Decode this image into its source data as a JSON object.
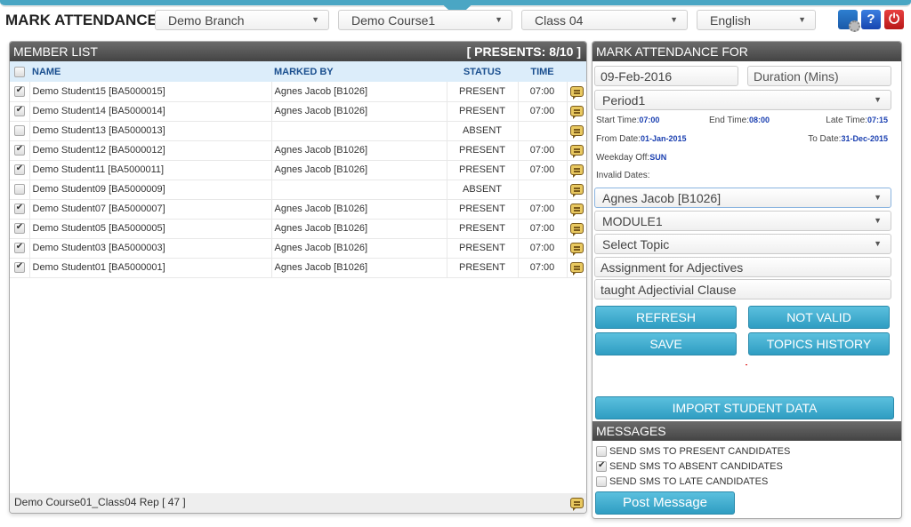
{
  "header": {
    "title": "MARK ATTENDANCE",
    "branch": "Demo Branch",
    "course": "Demo Course1",
    "class": "Class 04",
    "language": "English",
    "icons": [
      "settings-icon",
      "help-icon",
      "power-icon"
    ],
    "help_glyph": "?",
    "power_glyph": "⏻"
  },
  "member_list": {
    "title": "MEMBER LIST",
    "presents": "[ PRESENTS: 8/10 ]",
    "columns": {
      "name": "NAME",
      "marked_by": "MARKED BY",
      "status": "STATUS",
      "time": "TIME"
    },
    "rows": [
      {
        "checked": true,
        "name": "Demo Student15 [BA5000015]",
        "marked_by": "Agnes Jacob [B1026]",
        "status": "PRESENT",
        "time": "07:00"
      },
      {
        "checked": true,
        "name": "Demo Student14 [BA5000014]",
        "marked_by": "Agnes Jacob [B1026]",
        "status": "PRESENT",
        "time": "07:00"
      },
      {
        "checked": false,
        "name": "Demo Student13 [BA5000013]",
        "marked_by": "",
        "status": "ABSENT",
        "time": ""
      },
      {
        "checked": true,
        "name": "Demo Student12 [BA5000012]",
        "marked_by": "Agnes Jacob [B1026]",
        "status": "PRESENT",
        "time": "07:00"
      },
      {
        "checked": true,
        "name": "Demo Student11 [BA5000011]",
        "marked_by": "Agnes Jacob [B1026]",
        "status": "PRESENT",
        "time": "07:00"
      },
      {
        "checked": false,
        "name": "Demo Student09 [BA5000009]",
        "marked_by": "",
        "status": "ABSENT",
        "time": ""
      },
      {
        "checked": true,
        "name": "Demo Student07 [BA5000007]",
        "marked_by": "Agnes Jacob [B1026]",
        "status": "PRESENT",
        "time": "07:00"
      },
      {
        "checked": true,
        "name": "Demo Student05 [BA5000005]",
        "marked_by": "Agnes Jacob [B1026]",
        "status": "PRESENT",
        "time": "07:00"
      },
      {
        "checked": true,
        "name": "Demo Student03 [BA5000003]",
        "marked_by": "Agnes Jacob [B1026]",
        "status": "PRESENT",
        "time": "07:00"
      },
      {
        "checked": true,
        "name": "Demo Student01 [BA5000001]",
        "marked_by": "Agnes Jacob [B1026]",
        "status": "PRESENT",
        "time": "07:00"
      }
    ],
    "footer": "Demo Course01_Class04 Rep [ 47 ]"
  },
  "mark_for": {
    "title": "MARK ATTENDANCE FOR",
    "date": "09-Feb-2016",
    "duration_placeholder": "Duration (Mins)",
    "period": "Period1",
    "start_time_label": "Start Time:",
    "start_time": "07:00",
    "end_time_label": "End Time:",
    "end_time": "08:00",
    "late_time_label": "Late Time:",
    "late_time": "07:15",
    "from_date_label": "From Date:",
    "from_date": "01-Jan-2015",
    "to_date_label": "To Date:",
    "to_date": "31-Dec-2015",
    "weekday_off_label": "Weekday Off:",
    "weekday_off": "SUN",
    "invalid_dates_label": "Invalid Dates:",
    "faculty": "Agnes Jacob [B1026]",
    "module": "MODULE1",
    "topic": "Select Topic",
    "assignment": "Assignment for Adjectives",
    "taught": "taught Adjectivial Clause",
    "buttons": {
      "refresh": "REFRESH",
      "not_valid": "NOT VALID",
      "save": "SAVE",
      "topics_history": "TOPICS HISTORY",
      "import": "IMPORT STUDENT DATA"
    }
  },
  "messages": {
    "title": "MESSAGES",
    "options": [
      {
        "label": "SEND SMS TO PRESENT CANDIDATES",
        "checked": false
      },
      {
        "label": "SEND SMS TO ABSENT CANDIDATES",
        "checked": true
      },
      {
        "label": "SEND SMS TO LATE CANDIDATES",
        "checked": false
      }
    ],
    "post_button": "Post Message"
  },
  "colors": {
    "accent": "#4aa6c4",
    "button": "#2f9dc2",
    "panel_header": "#555555",
    "table_header_bg": "#dcedfa",
    "table_header_text": "#1a4f8f",
    "info_value": "#1a3fb0"
  }
}
